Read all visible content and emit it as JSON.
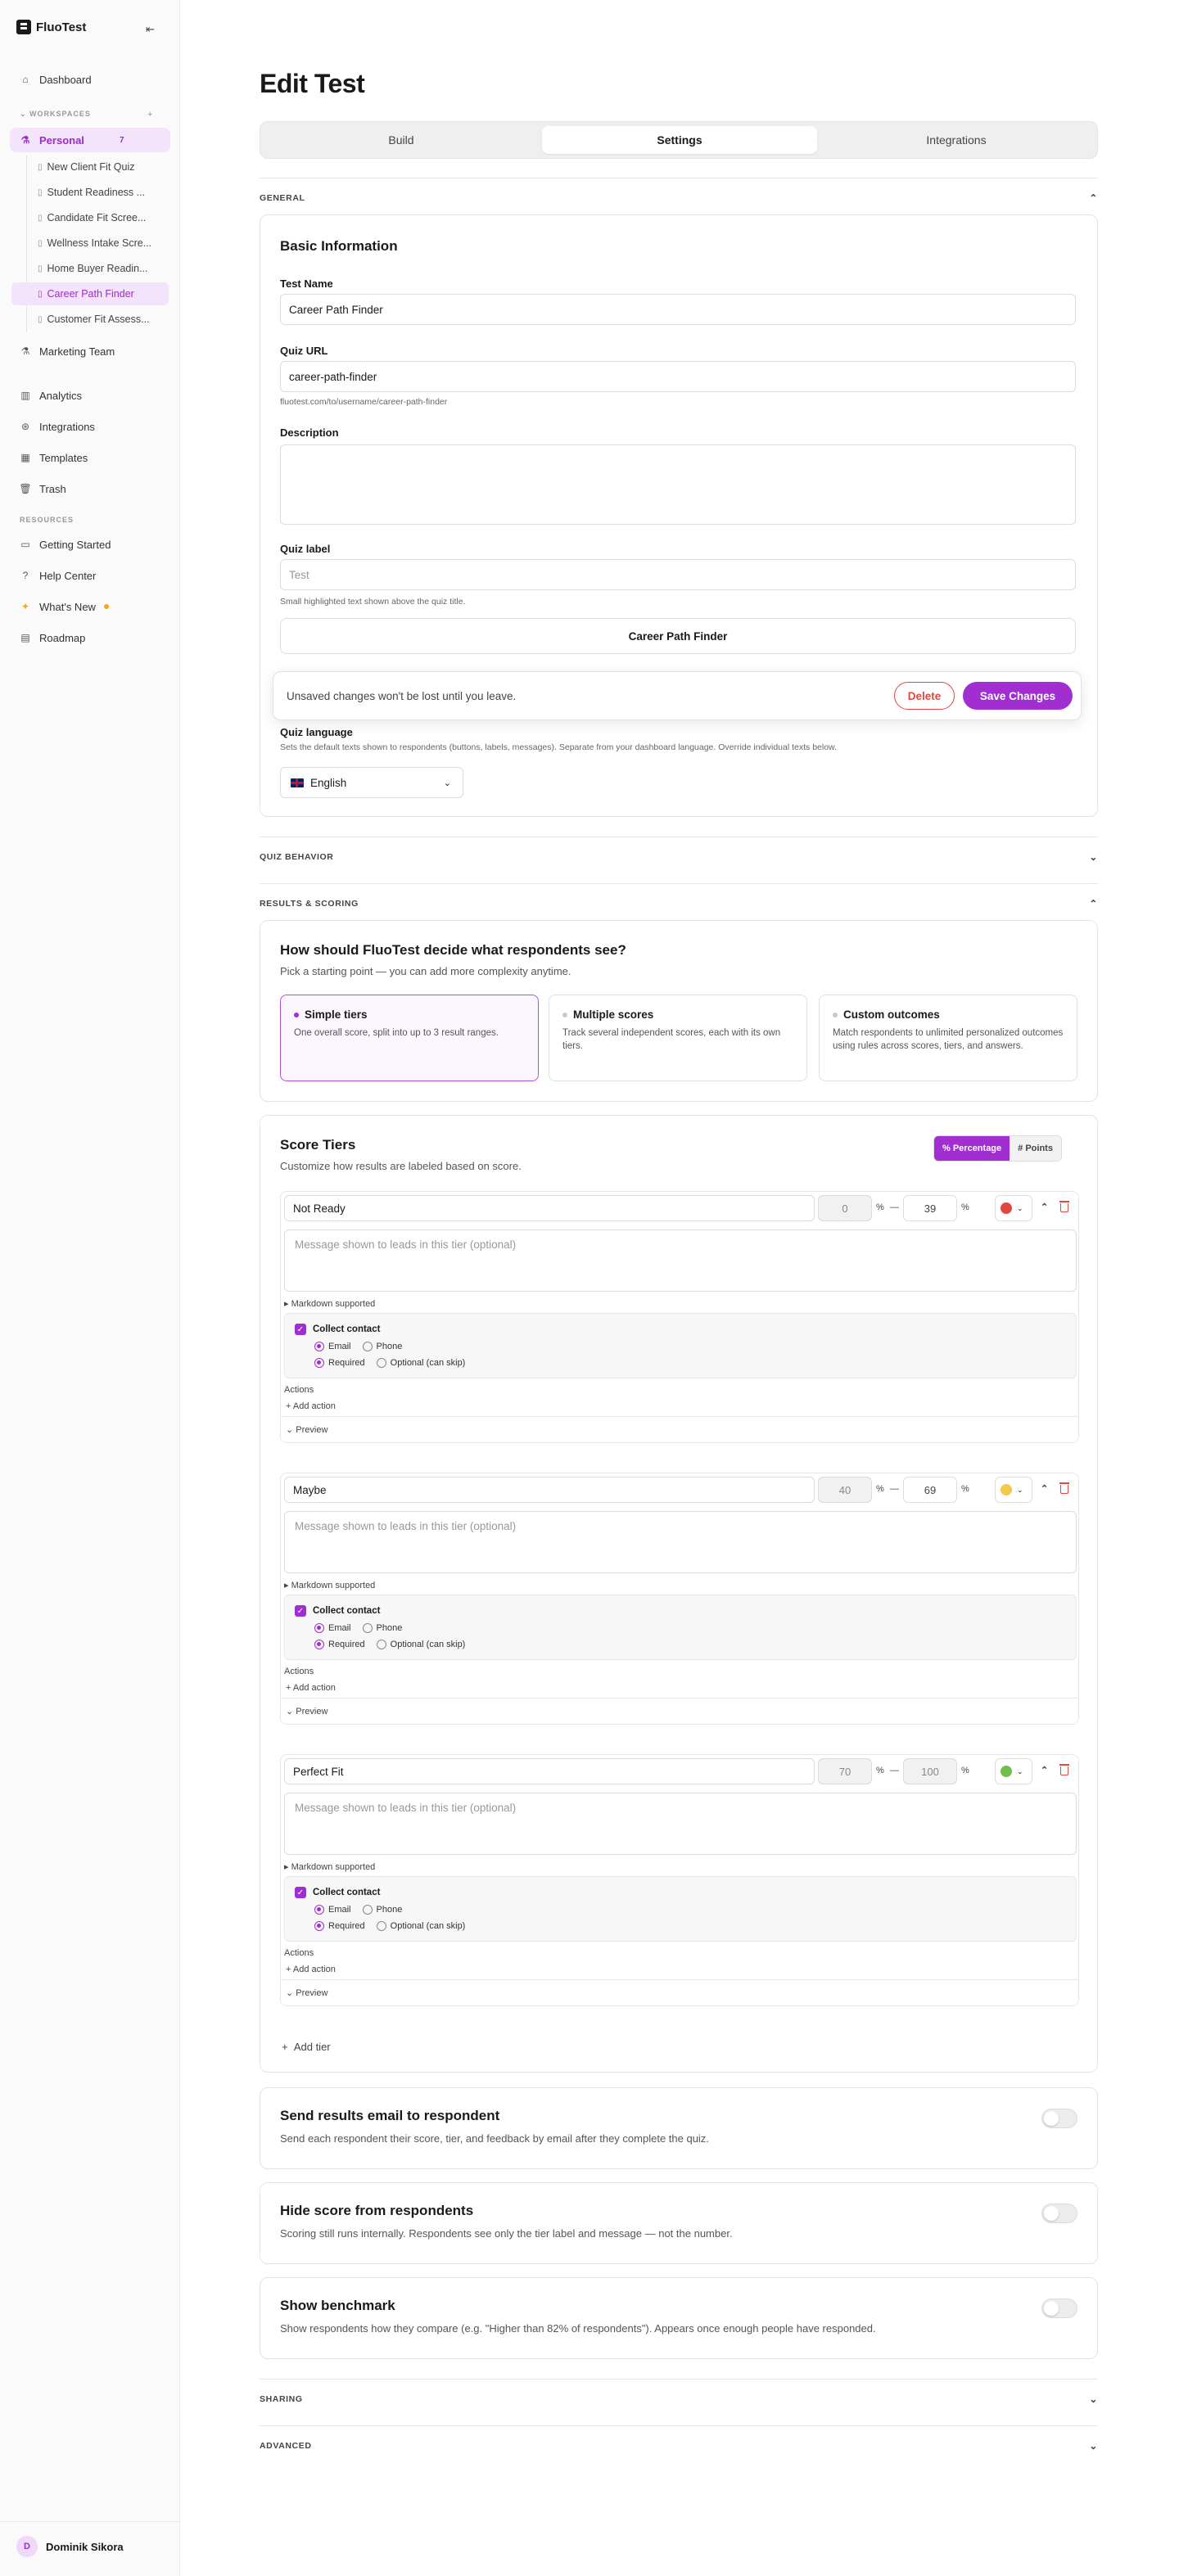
{
  "brand": {
    "name": "FluoTest"
  },
  "sidebar": {
    "dashboard": "Dashboard",
    "workspaces_label": "WORKSPACES",
    "workspace": {
      "label": "Personal",
      "badge": "7"
    },
    "tests": [
      {
        "label": "New Client Fit Quiz"
      },
      {
        "label": "Student Readiness ..."
      },
      {
        "label": "Candidate Fit Scree..."
      },
      {
        "label": "Wellness Intake Scre..."
      },
      {
        "label": "Home Buyer Readin..."
      },
      {
        "label": "Career Path Finder",
        "active": true
      },
      {
        "label": "Customer Fit Assess..."
      }
    ],
    "marketing_team": "Marketing Team",
    "analytics": "Analytics",
    "integrations": "Integrations",
    "templates": "Templates",
    "trash": "Trash",
    "resources_label": "RESOURCES",
    "getting_started": "Getting Started",
    "help_center": "Help Center",
    "whats_new": "What's New",
    "roadmap": "Roadmap",
    "user": {
      "initial": "D",
      "name": "Dominik Sikora"
    }
  },
  "page": {
    "title": "Edit Test",
    "tabs": [
      "Build",
      "Settings",
      "Integrations"
    ],
    "active_tab": "Settings"
  },
  "general": {
    "section_label": "GENERAL",
    "card_title": "Basic Information",
    "test_name_label": "Test Name",
    "test_name_value": "Career Path Finder",
    "quiz_url_label": "Quiz URL",
    "quiz_url_value": "career-path-finder",
    "quiz_url_hint": "fluotest.com/to/username/career-path-finder",
    "description_label": "Description",
    "description_value": "",
    "quiz_label_label": "Quiz label",
    "quiz_label_placeholder": "Test",
    "quiz_label_hint": "Small highlighted text shown above the quiz title.",
    "quiz_label_preview": "Career Path Finder",
    "language_label": "Quiz language",
    "language_hint": "Sets the default texts shown to respondents (buttons, labels, messages). Separate from your dashboard language. Override individual texts below.",
    "language_value": "English"
  },
  "toast": {
    "message": "Unsaved changes won't be lost until you leave.",
    "delete_label": "Delete",
    "save_label": "Save Changes"
  },
  "quiz_behavior": {
    "section_label": "QUIZ BEHAVIOR"
  },
  "results": {
    "section_label": "RESULTS & SCORING",
    "question": "How should FluoTest decide what respondents see?",
    "subtitle": "Pick a starting point — you can add more complexity anytime.",
    "options": [
      {
        "title": "Simple tiers",
        "desc": "One overall score, split into up to 3 result ranges.",
        "selected": true
      },
      {
        "title": "Multiple scores",
        "desc": "Track several independent scores, each with its own tiers."
      },
      {
        "title": "Custom outcomes",
        "desc": "Match respondents to unlimited personalized outcomes using rules across scores, tiers, and answers."
      }
    ]
  },
  "score_tiers": {
    "title": "Score Tiers",
    "subtitle": "Customize how results are labeled based on score.",
    "mode_percentage": "% Percentage",
    "mode_points": "# Points",
    "active_mode": "percentage",
    "unit": "%",
    "dash": "—",
    "message_placeholder": "Message shown to leads in this tier (optional)",
    "markdown_label": "▸ Markdown supported",
    "collect_contact": "Collect contact",
    "email": "Email",
    "phone": "Phone",
    "required": "Required",
    "optional": "Optional (can skip)",
    "actions_label": "Actions",
    "add_action": "+ Add action",
    "preview": "Preview",
    "add_tier": "Add tier",
    "tiers": [
      {
        "name": "Not Ready",
        "min": "0",
        "max": "39",
        "color": "#e0473d"
      },
      {
        "name": "Maybe",
        "min": "40",
        "max": "69",
        "color": "#f2c94c"
      },
      {
        "name": "Perfect Fit",
        "min": "70",
        "max": "100",
        "color": "#6fbf4a"
      }
    ]
  },
  "send_email": {
    "title": "Send results email to respondent",
    "desc": "Send each respondent their score, tier, and feedback by email after they complete the quiz.",
    "enabled": false
  },
  "hide_score": {
    "title": "Hide score from respondents",
    "desc": "Scoring still runs internally. Respondents see only the tier label and message — not the number.",
    "enabled": false
  },
  "benchmark": {
    "title": "Show benchmark",
    "desc": "Show respondents how they compare (e.g. \"Higher than 82% of respondents\"). Appears once enough people have responded.",
    "enabled": false
  },
  "sharing": {
    "section_label": "SHARING"
  },
  "advanced": {
    "section_label": "ADVANCED"
  },
  "colors": {
    "accent": "#a02ed1",
    "danger": "#e0473d"
  }
}
